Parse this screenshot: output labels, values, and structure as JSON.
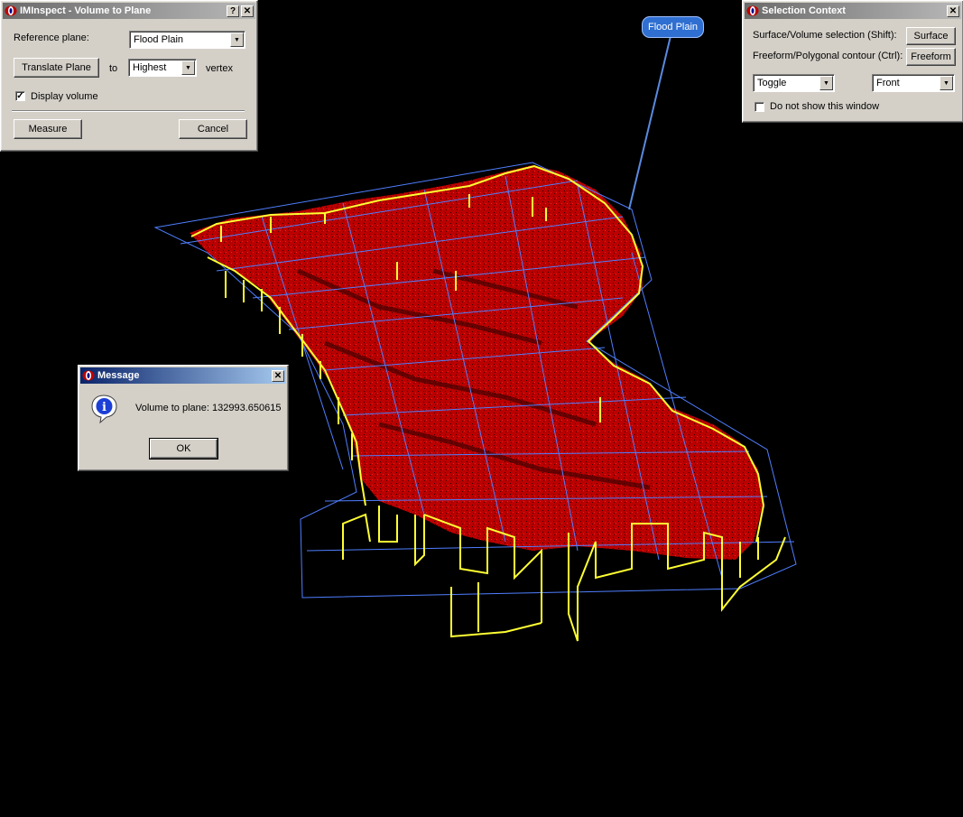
{
  "volume_dialog": {
    "title": "IMInspect - Volume to Plane",
    "help_btn": "?",
    "close_btn": "✕",
    "reference_plane_label": "Reference plane:",
    "reference_plane_value": "Flood Plain",
    "translate_btn": "Translate Plane",
    "to_label": "to",
    "vertex_select_value": "Highest",
    "vertex_label": "vertex",
    "display_volume_label": "Display volume",
    "display_volume_checked": true,
    "measure_btn": "Measure",
    "cancel_btn": "Cancel"
  },
  "selection_context": {
    "title": "Selection Context",
    "close_btn": "✕",
    "surface_label": "Surface/Volume selection (Shift):",
    "surface_btn": "Surface",
    "freeform_label": "Freeform/Polygonal contour (Ctrl):",
    "freeform_btn": "Freeform",
    "mode_value": "Toggle",
    "side_value": "Front",
    "do_not_show_label": "Do not show this window",
    "do_not_show_checked": false
  },
  "message_dialog": {
    "title": "Message",
    "close_btn": "✕",
    "info_icon": "i",
    "text": "Volume to plane: 132993.650615",
    "ok_btn": "OK"
  },
  "callout": {
    "label": "Flood Plain"
  },
  "colors": {
    "background": "#000000",
    "point_cloud": "#d10000",
    "walls": "#ffff33",
    "plane_grid": "#4f7fff",
    "active_title": "#0a246a"
  },
  "check_mark": "✓",
  "arrow_glyph": "▼"
}
